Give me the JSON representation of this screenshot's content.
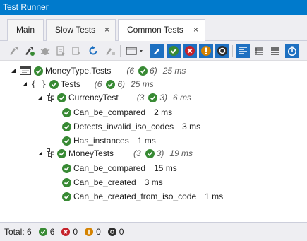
{
  "window": {
    "title": "Test Runner"
  },
  "tabs": [
    {
      "label": "Main",
      "active": false
    },
    {
      "label": "Slow Tests",
      "active": false,
      "closable": true
    },
    {
      "label": "Common Tests",
      "active": true,
      "closable": true
    }
  ],
  "tab_close_glyph": "×",
  "toolbar": {
    "icons": [
      "run-all-icon",
      "debug-all-icon",
      "cover-icon",
      "export-icon",
      "stop-icon",
      "rerun-icon",
      "clear-icon",
      "layout-dropdown-icon",
      "edit-icon",
      "filter-passed-icon",
      "filter-failed-icon",
      "filter-inconclusive-icon",
      "filter-ignored-icon",
      "group-lines-icon",
      "group-compact-icon",
      "group-flat-icon",
      "timer-icon"
    ]
  },
  "tree": {
    "root": {
      "label": "MoneyType.Tests",
      "total": "(6",
      "passed": "6)",
      "time": "25 ms"
    },
    "namespace": {
      "label": "Tests",
      "total": "(6",
      "passed": "6)",
      "time": "25 ms"
    },
    "fixtures": [
      {
        "label": "CurrencyTest",
        "total": "(3",
        "passed": "3)",
        "time": "6 ms",
        "tests": [
          {
            "name": "Can_be_compared",
            "time": "2 ms"
          },
          {
            "name": "Detects_invalid_iso_codes",
            "time": "3 ms"
          },
          {
            "name": "Has_instances",
            "time": "1 ms"
          }
        ]
      },
      {
        "label": "MoneyTests",
        "total": "(3",
        "passed": "3)",
        "time": "19 ms",
        "tests": [
          {
            "name": "Can_be_compared",
            "time": "15 ms"
          },
          {
            "name": "Can_be_created",
            "time": "3 ms"
          },
          {
            "name": "Can_be_created_from_iso_code",
            "time": "1 ms"
          }
        ]
      }
    ]
  },
  "status": {
    "total_label": "Total: 6",
    "passed": "6",
    "failed": "0",
    "inconclusive": "0",
    "ignored": "0"
  },
  "colors": {
    "accent": "#007acc",
    "passed": "#388a34",
    "failed": "#c5212a",
    "warning": "#d48200",
    "ignored": "#3a3a3a"
  }
}
